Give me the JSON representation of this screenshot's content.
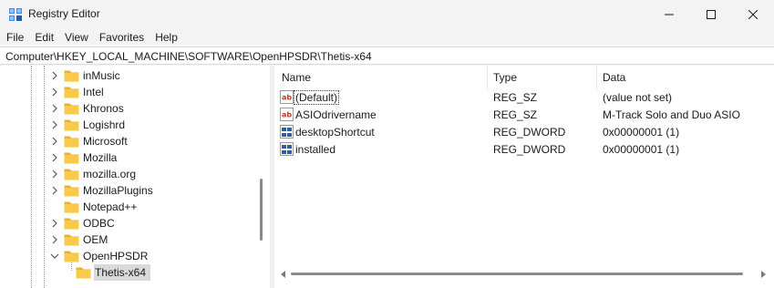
{
  "window": {
    "title": "Registry Editor",
    "icon": "registry-editor-icon",
    "controls": [
      "minimize",
      "maximize",
      "close"
    ]
  },
  "menu": {
    "items": [
      "File",
      "Edit",
      "View",
      "Favorites",
      "Help"
    ]
  },
  "address": {
    "path": "Computer\\HKEY_LOCAL_MACHINE\\SOFTWARE\\OpenHPSDR\\Thetis-x64"
  },
  "tree": {
    "items": [
      {
        "label": "inMusic",
        "expandable": true,
        "expanded": false
      },
      {
        "label": "Intel",
        "expandable": true,
        "expanded": false
      },
      {
        "label": "Khronos",
        "expandable": true,
        "expanded": false
      },
      {
        "label": "Logishrd",
        "expandable": true,
        "expanded": false
      },
      {
        "label": "Microsoft",
        "expandable": true,
        "expanded": false
      },
      {
        "label": "Mozilla",
        "expandable": true,
        "expanded": false
      },
      {
        "label": "mozilla.org",
        "expandable": true,
        "expanded": false
      },
      {
        "label": "MozillaPlugins",
        "expandable": true,
        "expanded": false
      },
      {
        "label": "Notepad++",
        "expandable": false,
        "expanded": false
      },
      {
        "label": "ODBC",
        "expandable": true,
        "expanded": false
      },
      {
        "label": "OEM",
        "expandable": true,
        "expanded": false
      },
      {
        "label": "OpenHPSDR",
        "expandable": true,
        "expanded": true
      },
      {
        "label": "Thetis-x64",
        "expandable": false,
        "selected": true,
        "child": true
      }
    ]
  },
  "list": {
    "columns": {
      "name": "Name",
      "type": "Type",
      "data": "Data"
    },
    "rows": [
      {
        "name": "(Default)",
        "type": "REG_SZ",
        "data": "(value not set)",
        "icon": "string-value-icon"
      },
      {
        "name": "ASIOdrivername",
        "type": "REG_SZ",
        "data": "M-Track Solo and Duo ASIO",
        "icon": "string-value-icon"
      },
      {
        "name": "desktopShortcut",
        "type": "REG_DWORD",
        "data": "0x00000001 (1)",
        "icon": "binary-value-icon"
      },
      {
        "name": "installed",
        "type": "REG_DWORD",
        "data": "0x00000001 (1)",
        "icon": "binary-value-icon"
      }
    ]
  },
  "colors": {
    "window_bg": "#f3f3f3",
    "pane_bg": "#ffffff",
    "selected_bg": "#d9d9d9",
    "folder": "#f8c94a",
    "string_icon": "#c0392b",
    "binary_icon": "#2a5ea8"
  }
}
